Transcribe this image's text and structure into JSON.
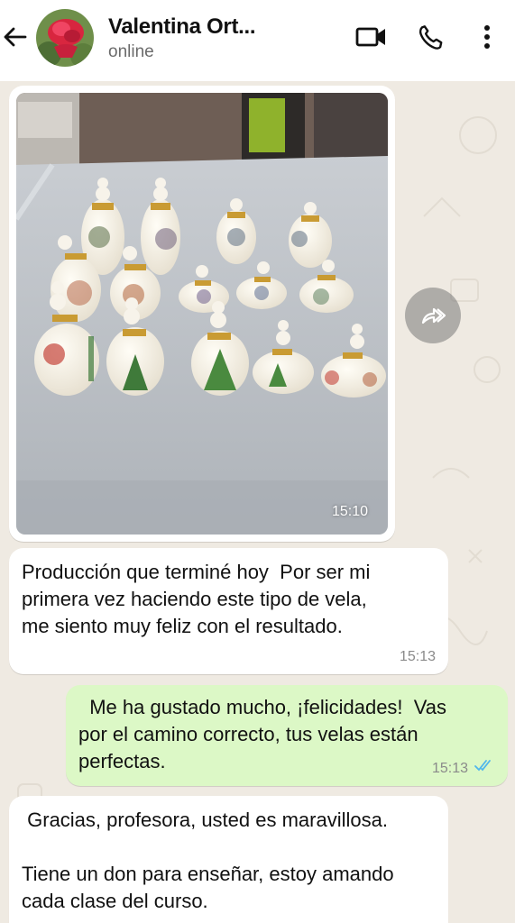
{
  "header": {
    "contact_name": "Valentina Ort...",
    "status": "online",
    "back_icon": "arrow-left-icon",
    "video_icon": "video-camera-icon",
    "call_icon": "phone-icon",
    "menu_icon": "more-vertical-icon"
  },
  "messages": [
    {
      "type": "image",
      "direction": "incoming",
      "time": "15:10"
    },
    {
      "type": "text",
      "direction": "incoming",
      "text": "Producción que terminé hoy  Por ser mi\nprimera vez haciendo este tipo de vela,\nme siento muy feliz con el resultado.",
      "time": "15:13"
    },
    {
      "type": "text",
      "direction": "outgoing",
      "text": "  Me ha gustado mucho, ¡felicidades!  Vas\npor el camino correcto, tus velas están\nperfectas.",
      "time": "15:13",
      "read": true
    },
    {
      "type": "text",
      "direction": "incoming",
      "text": " Gracias, profesora, usted es maravillosa.\n\nTiene un don para enseñar, estoy amando\ncada clase del curso."
    }
  ],
  "colors": {
    "incoming_bubble": "#ffffff",
    "outgoing_bubble": "#dcf8c6",
    "wallpaper": "#efeae2",
    "read_ticks": "#4fb6ec"
  }
}
